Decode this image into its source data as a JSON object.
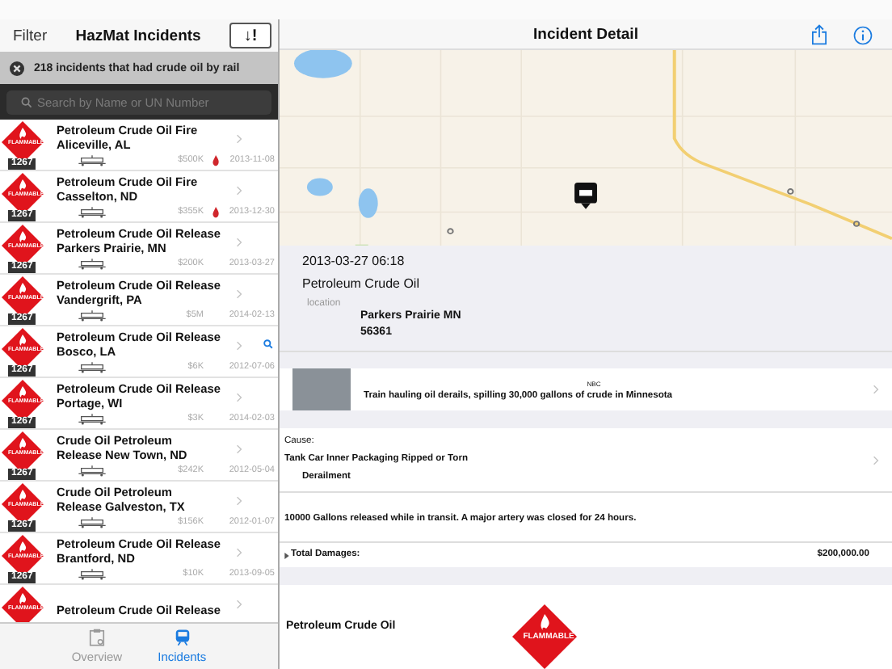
{
  "left": {
    "nav": {
      "filter": "Filter",
      "title": "HazMat Incidents",
      "sort_icon": "↓!"
    },
    "filter_bar": {
      "text": "218 incidents that had crude oil by rail"
    },
    "search": {
      "placeholder": "Search by Name or UN Number"
    },
    "incidents": [
      {
        "title": "Petroleum Crude Oil Fire",
        "place": "Aliceville, AL",
        "amount": "$500K",
        "date": "2013-11-08",
        "kind": "fire",
        "placard": "FLAMMABLE",
        "un": "1267"
      },
      {
        "title": "Petroleum Crude Oil Fire",
        "place": "Casselton, ND",
        "amount": "$355K",
        "date": "2013-12-30",
        "kind": "fire",
        "placard": "FLAMMABLE",
        "un": "1267"
      },
      {
        "title": "Petroleum Crude Oil Release",
        "place": "Parkers Prairie, MN",
        "amount": "$200K",
        "date": "2013-03-27",
        "kind": "plain",
        "placard": "FLAMMABLE",
        "un": "1267"
      },
      {
        "title": "Petroleum Crude Oil Release",
        "place": "Vandergrift, PA",
        "amount": "$5M",
        "date": "2014-02-13",
        "kind": "plain",
        "placard": "FLAMMABLE",
        "un": "1267"
      },
      {
        "title": "Petroleum Crude Oil Release",
        "place": "Bosco, LA",
        "amount": "$6K",
        "date": "2012-07-06",
        "kind": "found",
        "placard": "FLAMMABLE",
        "un": "1267"
      },
      {
        "title": "Petroleum Crude Oil Release",
        "place": "Portage, WI",
        "amount": "$3K",
        "date": "2014-02-03",
        "kind": "plain",
        "placard": "FLAMMABLE",
        "un": "1267"
      },
      {
        "title": "Crude Oil  Petroleum",
        "place": "Release New Town, ND",
        "amount": "$242K",
        "date": "2012-05-04",
        "kind": "plain",
        "placard": "FLAMMABLE",
        "un": "1267"
      },
      {
        "title": "Crude Oil  Petroleum",
        "place": "Release Galveston, TX",
        "amount": "$156K",
        "date": "2012-01-07",
        "kind": "plain",
        "placard": "FLAMMABLE",
        "un": "1267"
      },
      {
        "title": "Petroleum Crude Oil Release",
        "place": "Brantford, ND",
        "amount": "$10K",
        "date": "2013-09-05",
        "kind": "plain",
        "placard": "FLAMMABLE",
        "un": "1267"
      },
      {
        "title": "Petroleum Crude Oil Release",
        "kind": "plain",
        "placard": "FLAMMABLE"
      }
    ],
    "tabs": [
      {
        "label": "Overview",
        "selected": false
      },
      {
        "label": "Incidents",
        "selected": true
      }
    ]
  },
  "detail": {
    "title": "Incident Detail",
    "datetime": "2013-03-27 06:18",
    "material": "Petroleum Crude Oil",
    "location_label": "location",
    "location": "Parkers Prairie MN",
    "zip": "56361",
    "news": {
      "source": "NBC",
      "headline": "Train hauling oil derails, spilling 30,000 gallons of crude in Minnesota"
    },
    "cause_label": "Cause:",
    "cause": "Tank Car Inner Packaging Ripped or Torn",
    "cause_detail": "Derailment",
    "description": "10000 Gallons released while in transit.  A major artery was closed for 24 hours.",
    "damages_label": "Total Damages:",
    "damages": "$200,000.00",
    "cargo": {
      "name": "Petroleum Crude Oil",
      "placard": "FLAMMABLE"
    }
  }
}
